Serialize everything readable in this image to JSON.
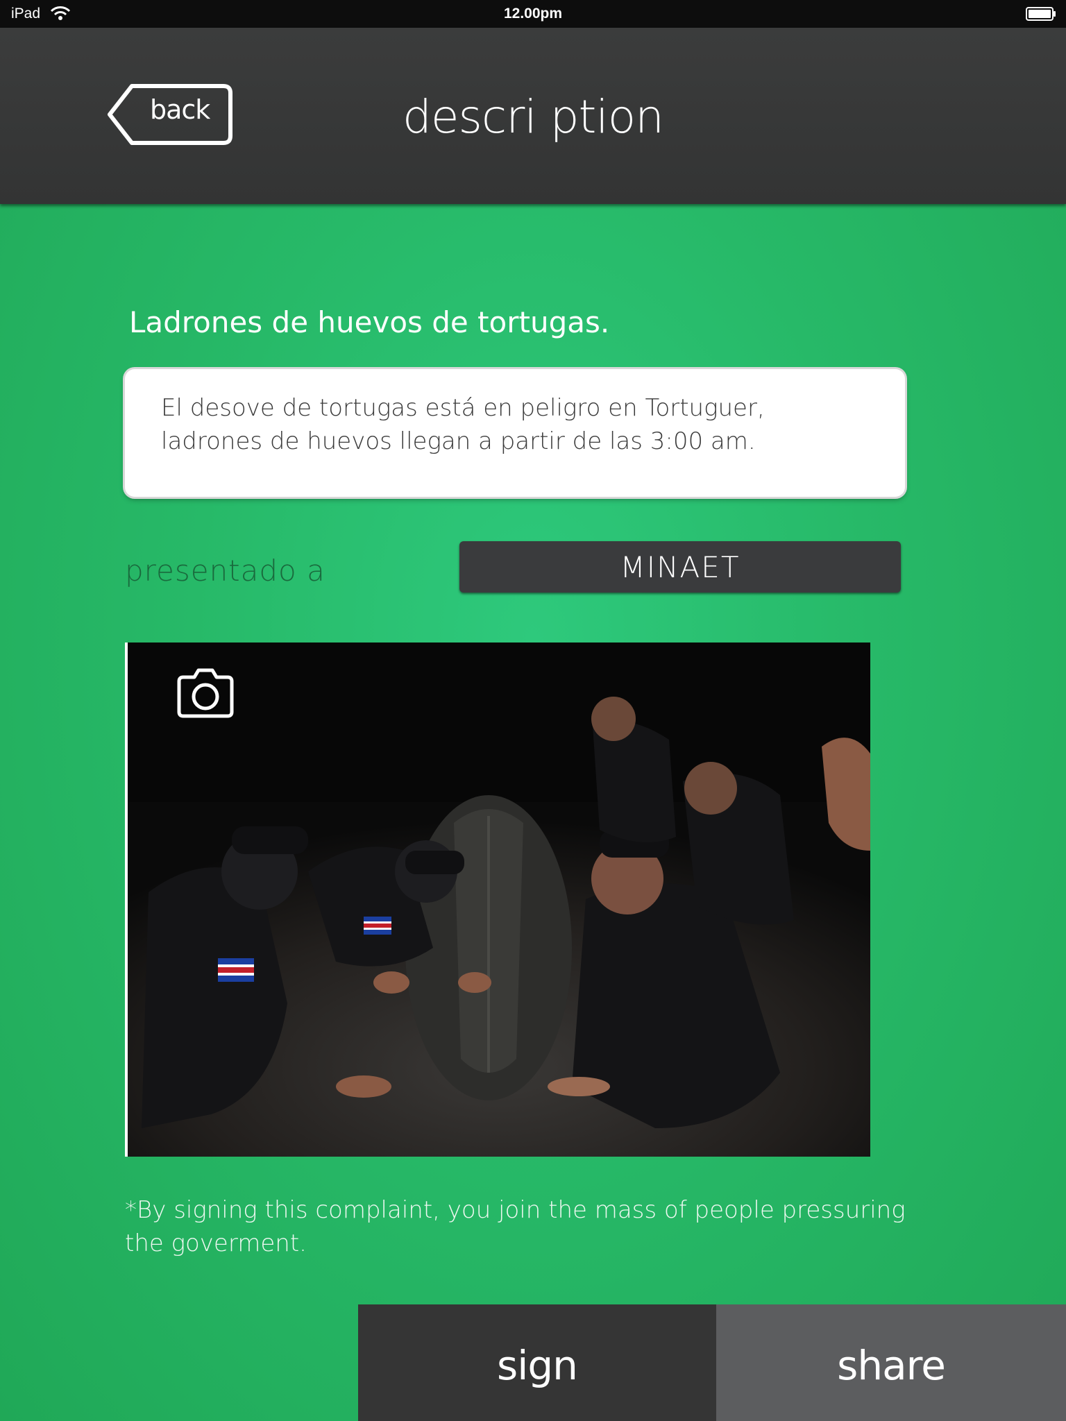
{
  "status_bar": {
    "device": "iPad",
    "time": "12.00pm"
  },
  "nav": {
    "back_label": "back",
    "title": "descri ption"
  },
  "complaint": {
    "title": "Ladrones de huevos de tortugas.",
    "description_line1": "El desove de tortugas está en peligro en Tortuguer,",
    "description_line2": "ladrones de huevos llegan a partir de las 3:00 am.",
    "presented_label": "presentado a",
    "recipient": "MINAET"
  },
  "photo": {
    "alt": "",
    "camera_icon": "camera-icon"
  },
  "footnote": {
    "line1": "*By signing this complaint, you join the mass of people pressuring",
    "line2": "the goverment."
  },
  "actions": {
    "sign_label": "sign",
    "share_label": "share"
  },
  "colors": {
    "background_green": "#27b968",
    "nav_dark": "#383939",
    "sign_bg": "#353535",
    "share_bg": "#5c5d5f"
  }
}
